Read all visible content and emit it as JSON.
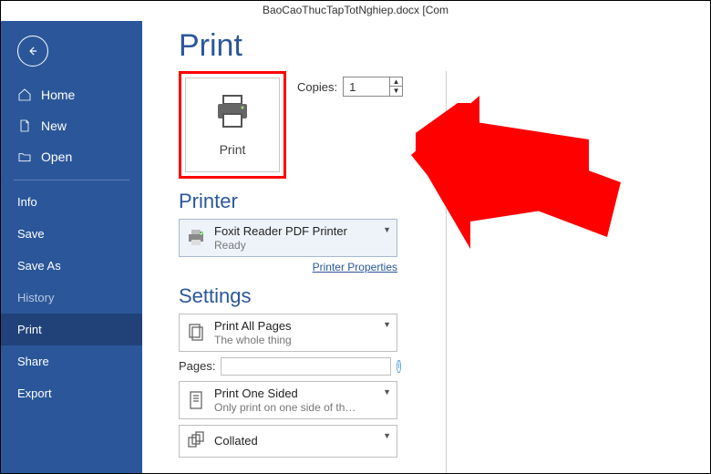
{
  "titlebar": {
    "doc": "BaoCaoThucTapTotNghiep.docx [Com"
  },
  "sidebar": {
    "items": [
      {
        "label": "Home"
      },
      {
        "label": "New"
      },
      {
        "label": "Open"
      }
    ],
    "subs": [
      {
        "label": "Info"
      },
      {
        "label": "Save"
      },
      {
        "label": "Save As"
      },
      {
        "label": "History"
      },
      {
        "label": "Print"
      },
      {
        "label": "Share"
      },
      {
        "label": "Export"
      }
    ]
  },
  "page": {
    "title": "Print",
    "print_btn": "Print",
    "copies_label": "Copies:",
    "copies_value": "1",
    "printer_h": "Printer",
    "printer_name": "Foxit Reader PDF Printer",
    "printer_status": "Ready",
    "printer_props": "Printer Properties",
    "settings_h": "Settings",
    "pages_label": "Pages:",
    "opt_allpages_t": "Print All Pages",
    "opt_allpages_s": "The whole thing",
    "opt_oneside_t": "Print One Sided",
    "opt_oneside_s": "Only print on one side of th…",
    "opt_collated_t": "Collated"
  }
}
